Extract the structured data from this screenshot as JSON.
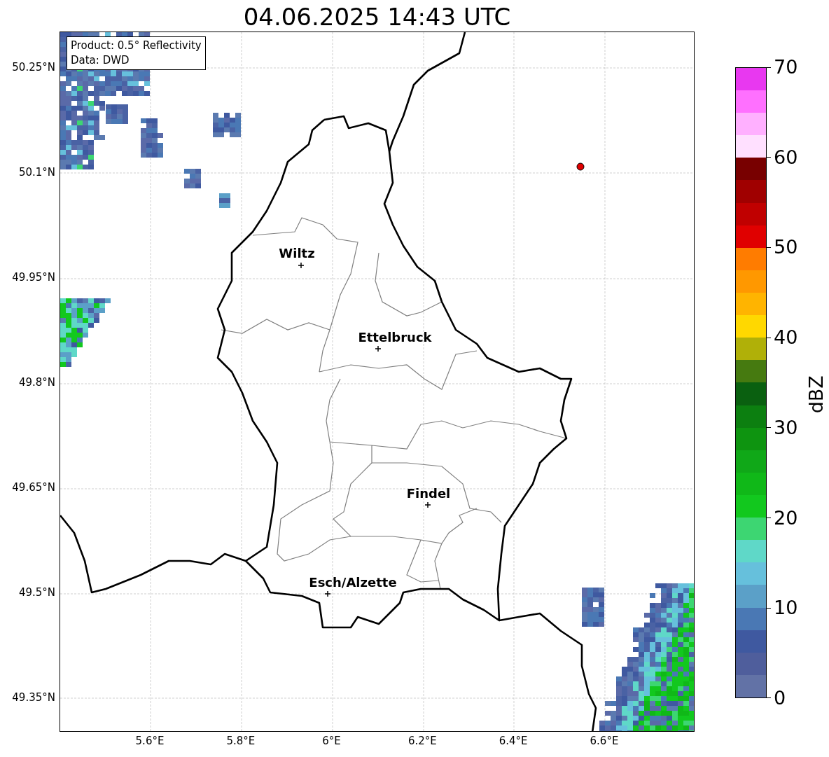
{
  "title": "04.06.2025 14:43 UTC",
  "info_box": [
    "Product: 0.5° Reflectivity",
    "Data: DWD"
  ],
  "y_ticks": [
    "50.25°N",
    "50.1°N",
    "49.95°N",
    "49.8°N",
    "49.65°N",
    "49.5°N",
    "49.35°N"
  ],
  "x_ticks": [
    "5.6°E",
    "5.8°E",
    "6°E",
    "6.2°E",
    "6.4°E",
    "6.6°E"
  ],
  "cities": [
    {
      "name": "Wiltz"
    },
    {
      "name": "Ettelbruck"
    },
    {
      "name": "Findel"
    },
    {
      "name": "Esch/Alzette"
    }
  ],
  "colorbar": {
    "label": "dBZ",
    "ticks": [
      "70",
      "60",
      "50",
      "40",
      "30",
      "20",
      "10",
      "0"
    ],
    "bins": [
      {
        "color": "#6272a6"
      },
      {
        "color": "#4f5e9c"
      },
      {
        "color": "#3f59a0"
      },
      {
        "color": "#4a78b4"
      },
      {
        "color": "#5ba0c8"
      },
      {
        "color": "#66c0dc"
      },
      {
        "color": "#5fd8c8"
      },
      {
        "color": "#3dd672"
      },
      {
        "color": "#12c81e"
      },
      {
        "color": "#10b818"
      },
      {
        "color": "#10a818"
      },
      {
        "color": "#0e9410"
      },
      {
        "color": "#0c7f10"
      },
      {
        "color": "#0a6010"
      },
      {
        "color": "#467a10"
      },
      {
        "color": "#b0b008"
      },
      {
        "color": "#ffd800"
      },
      {
        "color": "#ffb400"
      },
      {
        "color": "#ff9800"
      },
      {
        "color": "#ff7c00"
      },
      {
        "color": "#e00000"
      },
      {
        "color": "#c00000"
      },
      {
        "color": "#a00000"
      },
      {
        "color": "#780000"
      },
      {
        "color": "#ffe0ff"
      },
      {
        "color": "#ffb0ff"
      },
      {
        "color": "#ff70ff"
      },
      {
        "color": "#e838f0"
      }
    ]
  }
}
